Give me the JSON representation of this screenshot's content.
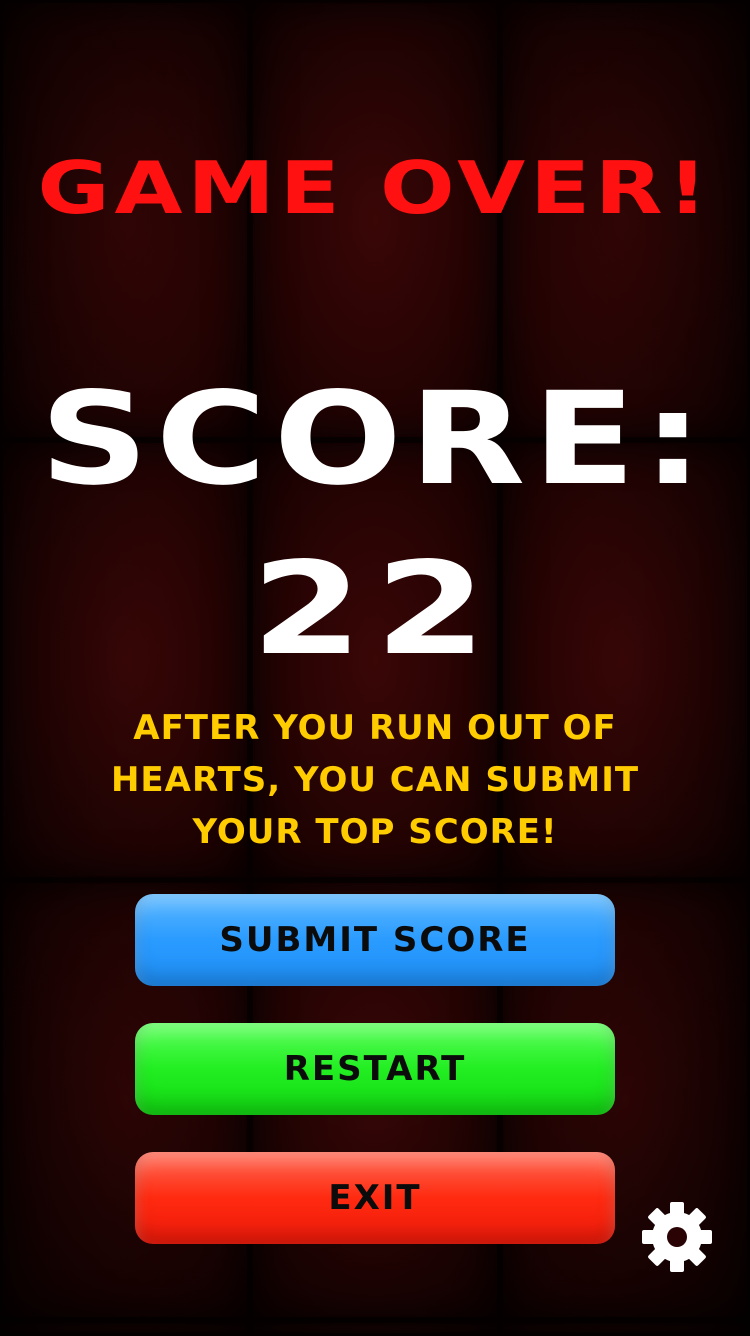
{
  "game_over": {
    "title": "GAME OVER!",
    "score_label": "SCORE:",
    "score_value": "22",
    "hint": "AFTER YOU RUN OUT OF HEARTS, YOU CAN SUBMIT YOUR TOP SCORE!"
  },
  "buttons": {
    "submit": "SUBMIT SCORE",
    "restart": "RESTART",
    "exit": "EXIT"
  },
  "icons": {
    "settings": "gear-icon"
  },
  "colors": {
    "title": "#ff1111",
    "score": "#ffffff",
    "hint": "#ffcc00",
    "submit": "#2a9bff",
    "restart": "#22ee22",
    "exit": "#ff2a10",
    "background": "#2a0404"
  }
}
